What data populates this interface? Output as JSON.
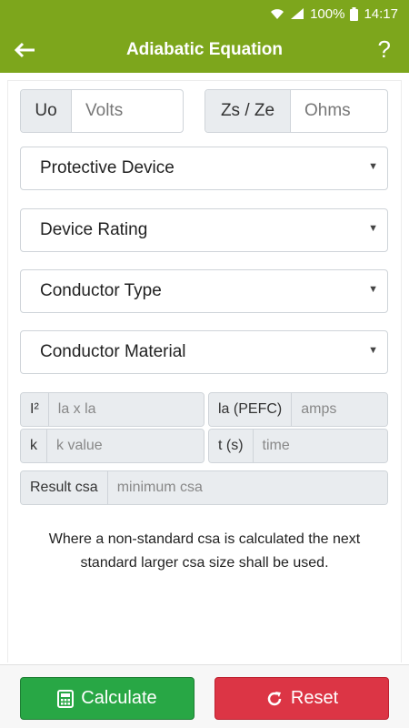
{
  "status": {
    "battery": "100%",
    "time": "14:17"
  },
  "header": {
    "title": "Adiabatic Equation",
    "help": "?"
  },
  "inputs": {
    "uo": {
      "label": "Uo",
      "placeholder": "Volts"
    },
    "zs": {
      "label": "Zs / Ze",
      "placeholder": "Ohms"
    }
  },
  "selects": [
    {
      "label": "Protective Device"
    },
    {
      "label": "Device Rating"
    },
    {
      "label": "Conductor Type"
    },
    {
      "label": "Conductor Material"
    }
  ],
  "calc": {
    "i2": {
      "label": "I²",
      "placeholder": "la x la"
    },
    "ia": {
      "label": "la (PEFC)",
      "placeholder": "amps"
    },
    "k": {
      "label": "k",
      "placeholder": "k value"
    },
    "t": {
      "label": "t (s)",
      "placeholder": "time"
    },
    "result": {
      "label": "Result csa",
      "placeholder": "minimum csa"
    }
  },
  "note": "Where a non-standard csa is calculated the next standard larger csa size shall be used.",
  "buttons": {
    "calculate": "Calculate",
    "reset": "Reset"
  },
  "colors": {
    "primary": "#7da61c",
    "success": "#28a745",
    "danger": "#dc3545"
  }
}
